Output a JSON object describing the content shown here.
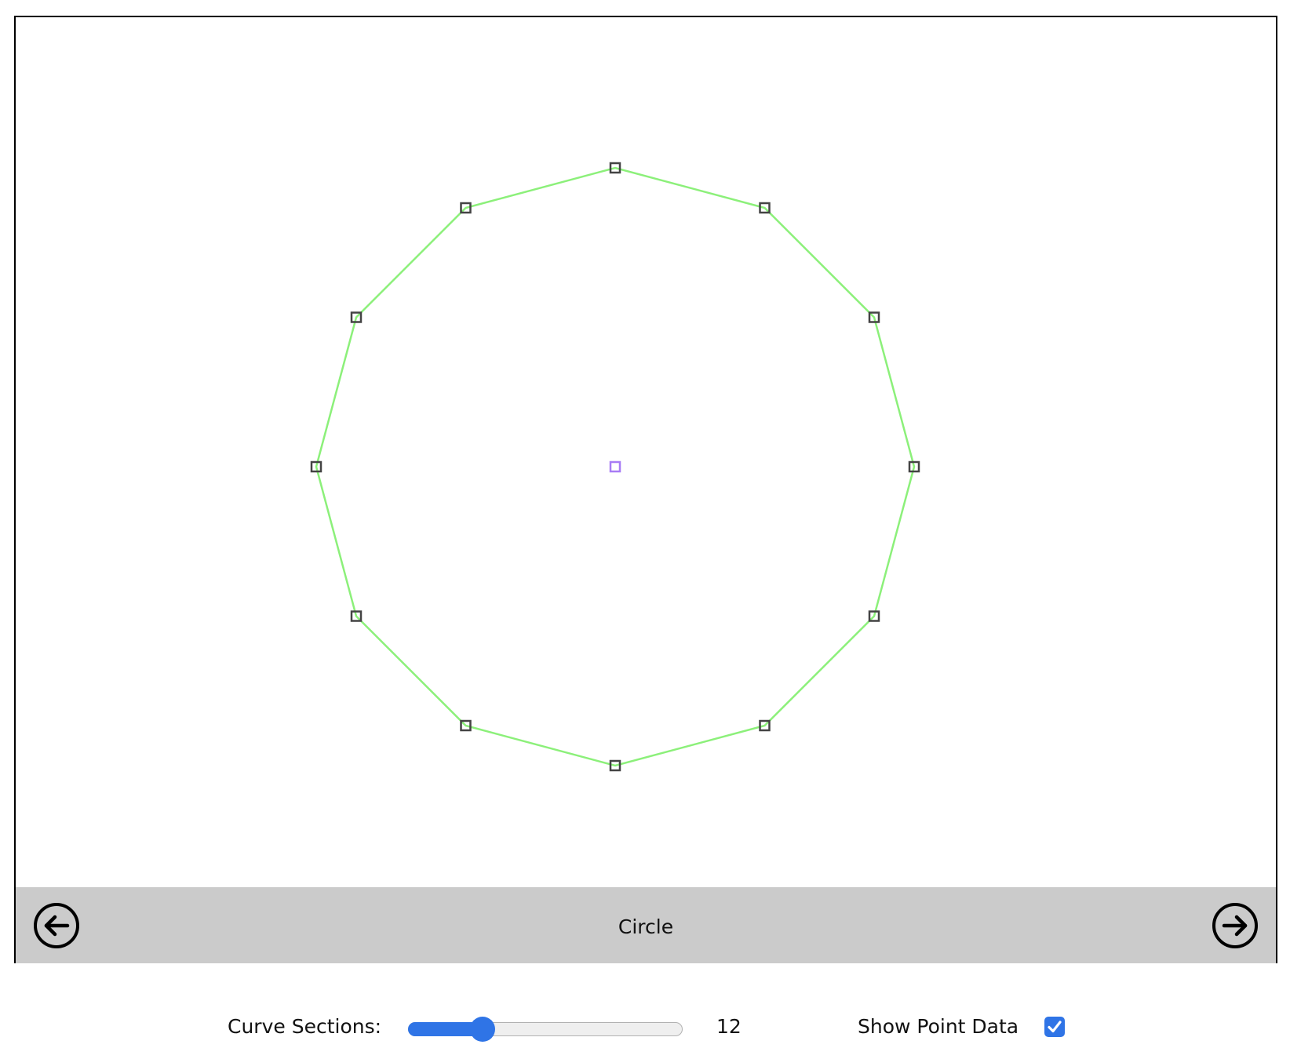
{
  "shape": {
    "name": "Circle",
    "point_count": 12,
    "line_color": "#8cf07a",
    "point_color": "#444444",
    "center_point_color": "#a87cf5"
  },
  "nav": {
    "prev_icon": "arrow-left-circle-icon",
    "next_icon": "arrow-right-circle-icon"
  },
  "controls": {
    "sections_label": "Curve Sections:",
    "sections_value": "12",
    "sections_fraction": 0.27,
    "show_points_label": "Show Point Data",
    "show_points_checked": true,
    "accent_color": "#2f74e6"
  }
}
